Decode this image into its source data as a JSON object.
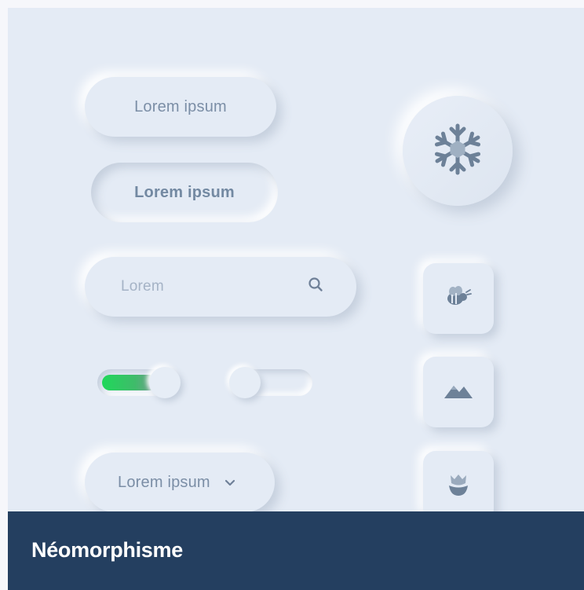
{
  "buttons": {
    "raised_label": "Lorem ipsum",
    "pressed_label": "Lorem ipsum"
  },
  "search": {
    "placeholder": "Lorem",
    "icon": "search-icon"
  },
  "toggles": {
    "first_on": true,
    "second_on": false
  },
  "select": {
    "value": "Lorem ipsum",
    "icon": "chevron-down-icon"
  },
  "icons": [
    "snowflake-icon",
    "bee-icon",
    "mountain-icon",
    "tulip-icon"
  ],
  "footer": {
    "title": "Néomorphisme"
  },
  "colors": {
    "background": "#e4ebf5",
    "text": "#7b8ea6",
    "footer": "#243f60",
    "toggle_active": "#1fd85a"
  }
}
